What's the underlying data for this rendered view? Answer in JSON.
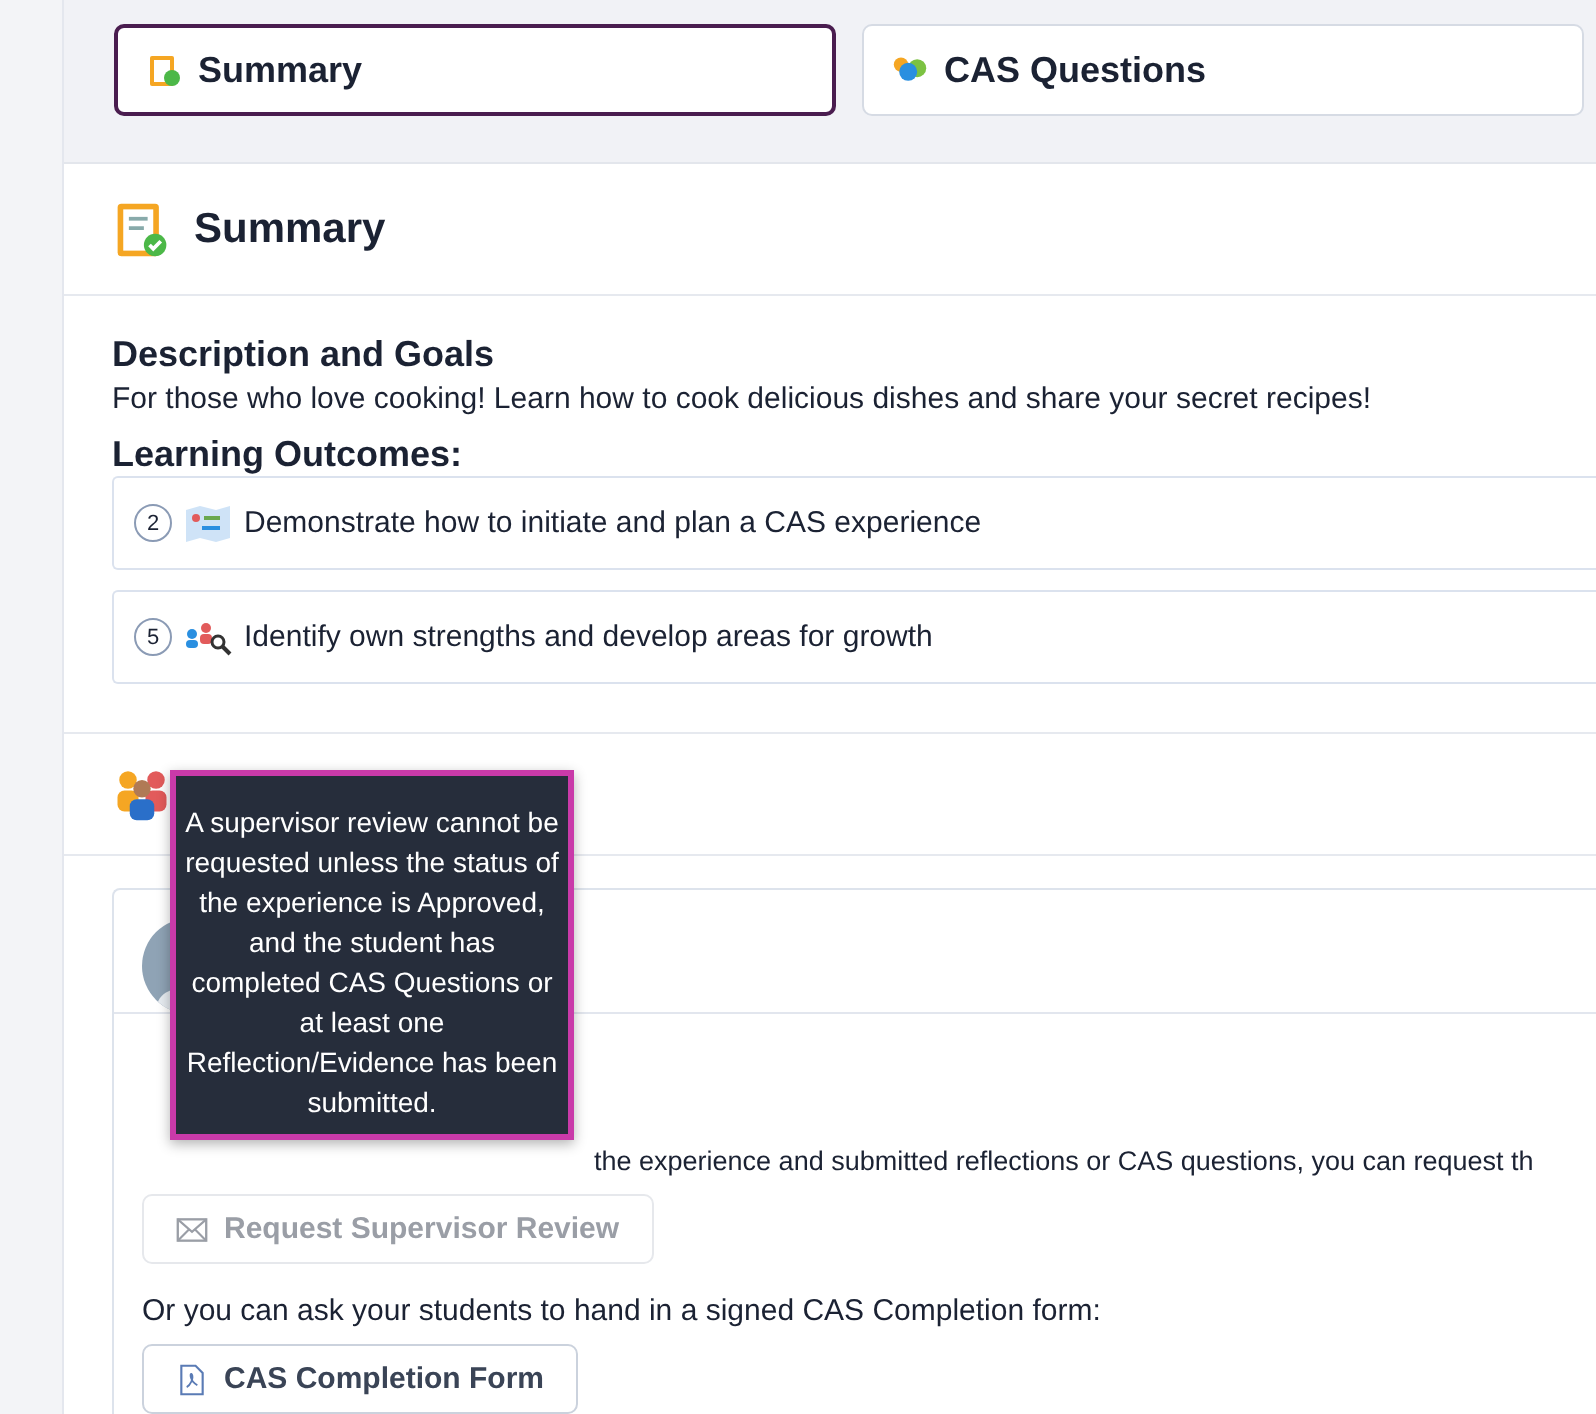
{
  "tabs": [
    {
      "label": "Summary",
      "selected": true
    },
    {
      "label": "CAS Questions",
      "selected": false
    }
  ],
  "summary": {
    "title": "Summary",
    "description_heading": "Description and Goals",
    "description": "For those who love cooking! Learn how to cook delicious dishes and share your secret recipes!",
    "outcomes_heading": "Learning Outcomes:",
    "outcomes": [
      {
        "number": "2",
        "text": "Demonstrate how to initiate and plan a CAS experience"
      },
      {
        "number": "5",
        "text": "Identify own strengths and develop areas for growth"
      }
    ]
  },
  "supervisor_review": {
    "next_steps_text": "the experience and submitted reflections or CAS questions, you can request th",
    "buttons": [
      {
        "label": "Request Supervisor Review",
        "disabled": true
      }
    ],
    "form_text": "Or you can ask your students to hand in a signed CAS Completion form:",
    "form_button": {
      "label": "CAS Completion Form",
      "disabled": false
    }
  },
  "tooltip": {
    "text": "A supervisor review cannot be requested unless the status of the experience is Approved, and the student has completed CAS Questions or at least one Reflection/Evidence has been submitted."
  }
}
